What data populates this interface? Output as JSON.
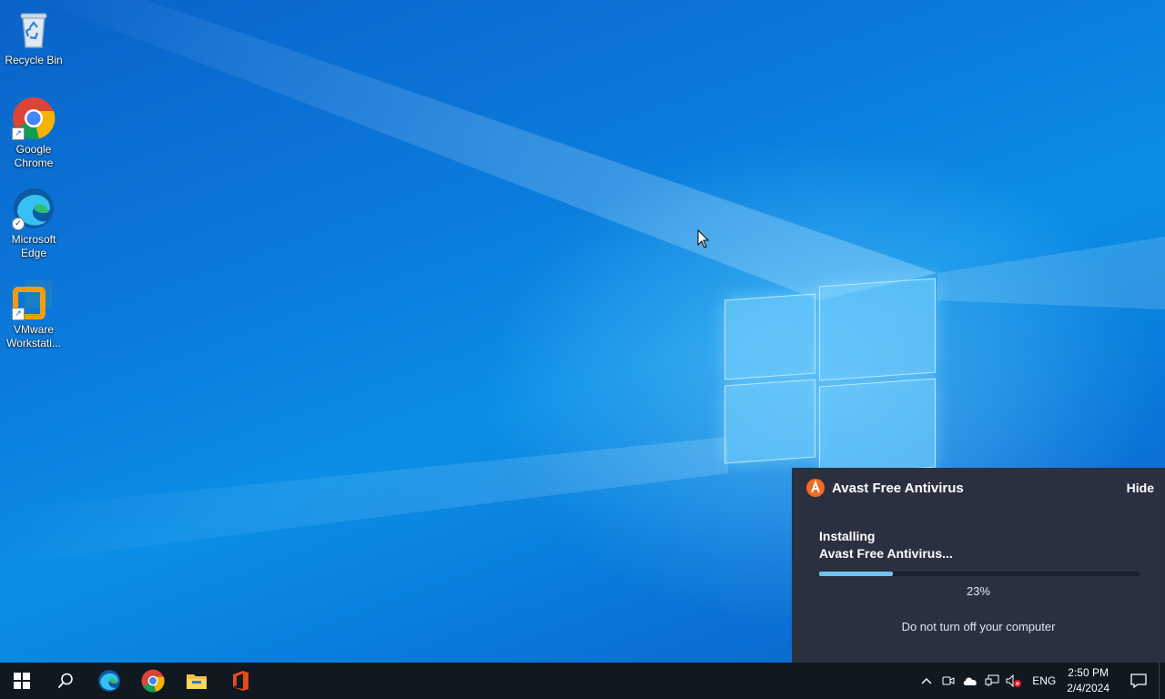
{
  "desktop": {
    "icons": [
      {
        "label": "Recycle Bin",
        "icon": "recycle-bin-icon"
      },
      {
        "label": "Google Chrome",
        "icon": "chrome-icon"
      },
      {
        "label": "Microsoft Edge",
        "icon": "edge-icon"
      },
      {
        "label": "VMware Workstati...",
        "icon": "vmware-icon"
      }
    ]
  },
  "avast_popup": {
    "title": "Avast Free Antivirus",
    "hide_label": "Hide",
    "status_line1": "Installing",
    "status_line2": "Avast Free Antivirus...",
    "percent_text": "23%",
    "progress": 0.23,
    "note": "Do not turn off your computer",
    "colors": {
      "background": "#2b3041",
      "progress": "#6fc3ef",
      "brand": "#f26b21"
    }
  },
  "taskbar": {
    "pinned": [
      {
        "name": "start-button",
        "icon": "windows-icon"
      },
      {
        "name": "search-button",
        "icon": "search-icon"
      },
      {
        "name": "taskbar-edge",
        "icon": "edge-icon"
      },
      {
        "name": "taskbar-chrome",
        "icon": "chrome-icon"
      },
      {
        "name": "taskbar-file-explorer",
        "icon": "folder-icon"
      },
      {
        "name": "taskbar-office",
        "icon": "office-icon"
      }
    ],
    "tray": {
      "icons": [
        "chevron-up-icon",
        "meet-now-icon",
        "onedrive-icon",
        "network-icon",
        "volume-muted-icon"
      ],
      "language": "ENG",
      "time": "2:50 PM",
      "date": "2/4/2024",
      "notification_icon": "action-center-icon"
    }
  }
}
